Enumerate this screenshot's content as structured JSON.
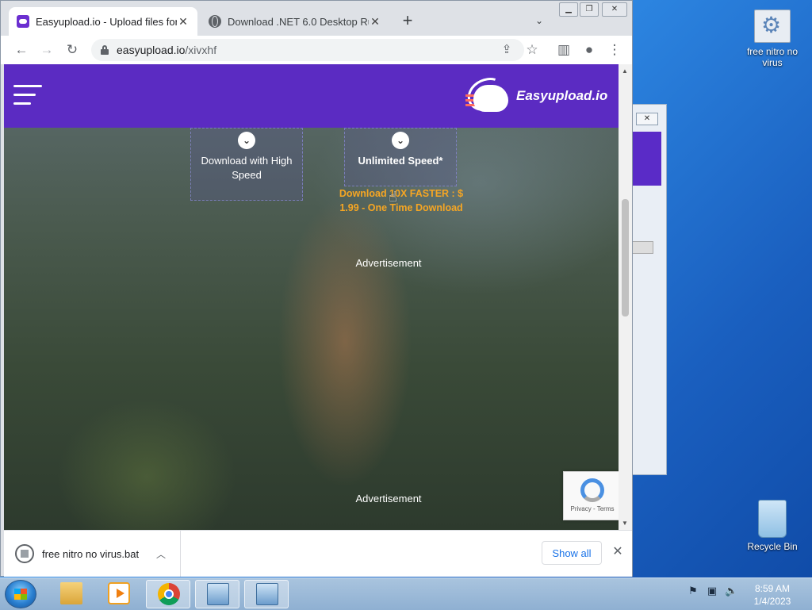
{
  "desktop": {
    "icons": [
      {
        "label": "free nitro no virus"
      },
      {
        "label": "Recycle Bin"
      }
    ]
  },
  "browser": {
    "tabs": [
      {
        "title": "Easyupload.io - Upload files for f",
        "active": true
      },
      {
        "title": "Download .NET 6.0 Desktop Runt",
        "active": false
      }
    ],
    "url_host": "easyupload.io",
    "url_path": "/xivxhf",
    "icons": {
      "back": "back-arrow-icon",
      "forward": "forward-arrow-icon",
      "reload": "reload-icon",
      "share": "share-icon",
      "bookmark": "star-icon",
      "sidepanel": "side-panel-icon",
      "profile": "profile-icon",
      "menu": "kebab-menu-icon"
    }
  },
  "page": {
    "logo_text": "Easyupload.io",
    "brand_color": "#5b2bc2",
    "download_high": "Download with High Speed",
    "unlimited": "Unlimited Speed*",
    "promo": "Download 10X FASTER : $ 1.99 - One Time Download",
    "advertisement_1": "Advertisement",
    "advertisement_2": "Advertisement",
    "recaptcha": "Privacy - Terms"
  },
  "downloads": {
    "file_name": "free nitro no virus.bat",
    "show_all": "Show all"
  },
  "taskbar": {
    "time": "8:59 AM",
    "date": "1/4/2023"
  }
}
